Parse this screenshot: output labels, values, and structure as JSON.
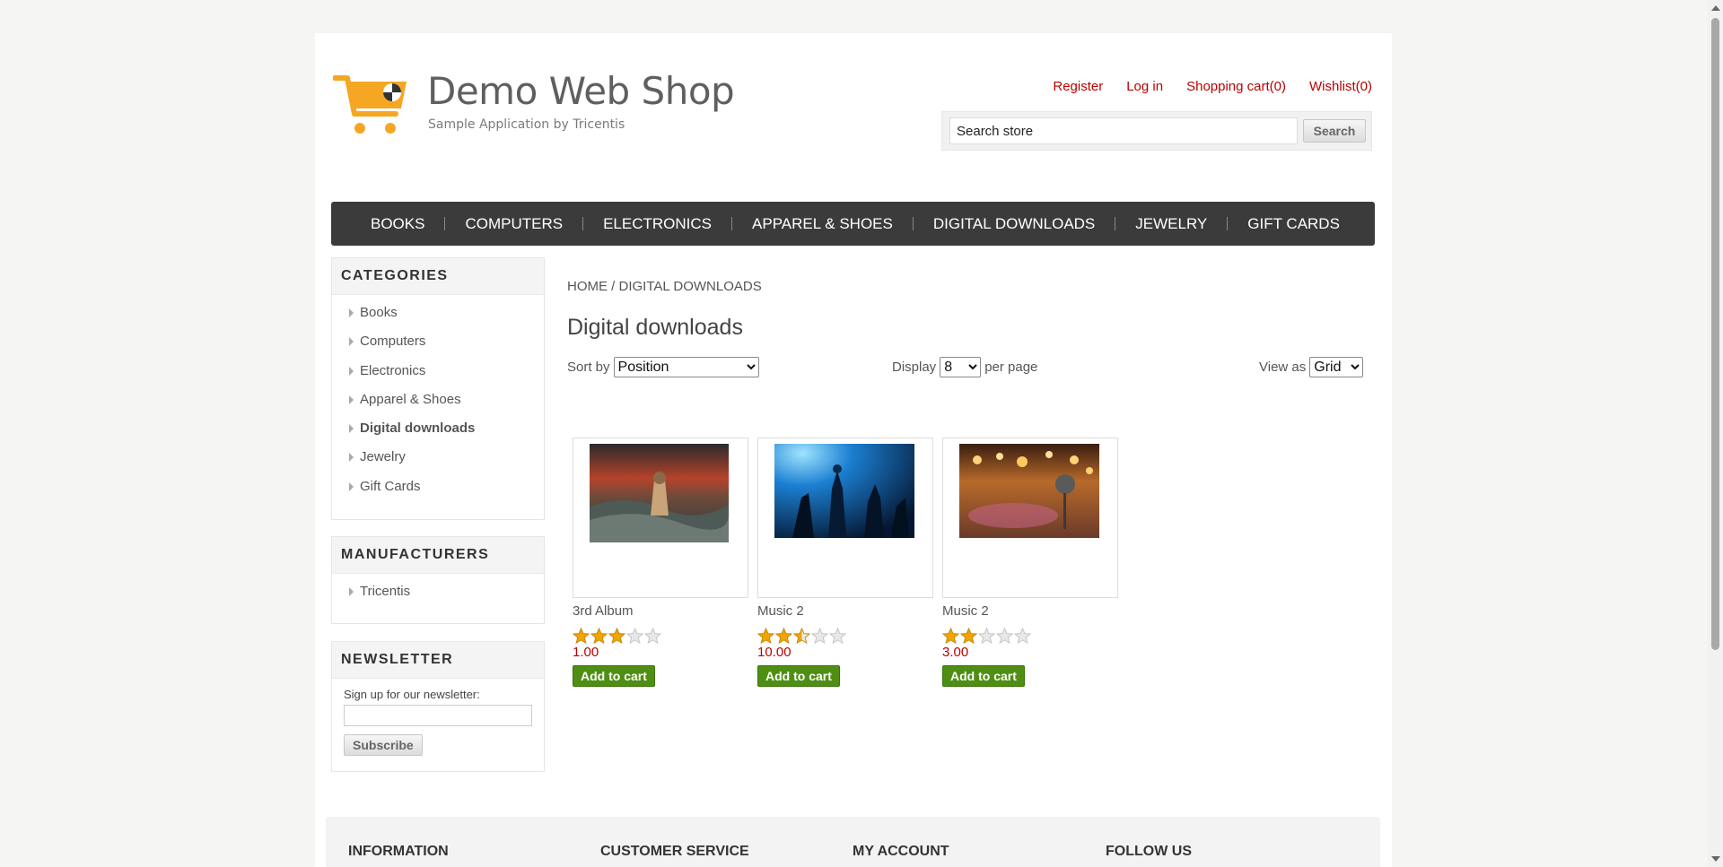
{
  "header": {
    "brand_title": "Demo Web Shop",
    "brand_subtitle": "Sample Application by Tricentis",
    "links": {
      "register": "Register",
      "login": "Log in",
      "cart": "Shopping cart(0)",
      "wishlist": "Wishlist(0)"
    },
    "search": {
      "value": "Search store",
      "button": "Search"
    }
  },
  "top_menu": [
    "BOOKS",
    "COMPUTERS",
    "ELECTRONICS",
    "APPAREL & SHOES",
    "DIGITAL DOWNLOADS",
    "JEWELRY",
    "GIFT CARDS"
  ],
  "categories": {
    "title": "CATEGORIES",
    "items": [
      "Books",
      "Computers",
      "Electronics",
      "Apparel & Shoes",
      "Digital downloads",
      "Jewelry",
      "Gift Cards"
    ],
    "active": "Digital downloads"
  },
  "manufacturers": {
    "title": "MANUFACTURERS",
    "items": [
      "Tricentis"
    ]
  },
  "newsletter": {
    "title": "NEWSLETTER",
    "label": "Sign up for our newsletter:",
    "button": "Subscribe"
  },
  "breadcrumb": {
    "home": "HOME",
    "separator": "/",
    "current": "DIGITAL DOWNLOADS"
  },
  "page_title": "Digital downloads",
  "controls": {
    "sort_label": "Sort by",
    "sort_value": "Position",
    "display_label": "Display",
    "display_value": "8",
    "per_page": "per page",
    "view_label": "View as",
    "view_value": "Grid"
  },
  "products": [
    {
      "name": "3rd Album",
      "rating": 3,
      "price": "1.00",
      "button": "Add to cart",
      "image": "stormy-sea-album-art"
    },
    {
      "name": "Music 2",
      "rating": 2.5,
      "price": "10.00",
      "button": "Add to cart",
      "image": "blue-concert-crowd"
    },
    {
      "name": "Music 2",
      "rating": 2,
      "price": "3.00",
      "button": "Add to cart",
      "image": "microphone-stage-lights"
    }
  ],
  "footer": {
    "columns": [
      "INFORMATION",
      "CUSTOMER SERVICE",
      "MY ACCOUNT",
      "FOLLOW US"
    ]
  },
  "colors": {
    "link_red": "#b00000",
    "menu_bg": "#3b3b3b",
    "add_to_cart_green": "#4e8f13",
    "star_gold": "#f0a500"
  }
}
